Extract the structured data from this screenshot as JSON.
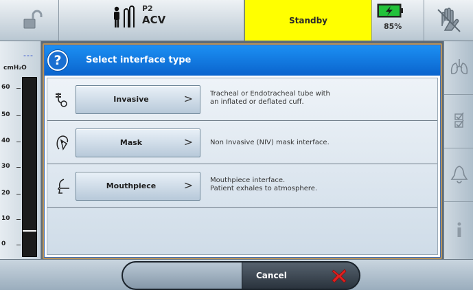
{
  "status_bar": {
    "mode_label": "P2",
    "mode_value": "ACV",
    "ventilation_state": "Standby",
    "battery_percent": "85%",
    "icons": [
      "unlock-icon",
      "patient-circuit-icon",
      "battery-charging-icon",
      "alarm-silence-hand-icon"
    ]
  },
  "pressure_gauge": {
    "current_value": "---",
    "unit": "cmH₂O",
    "ticks": [
      "60",
      "50",
      "40",
      "30",
      "20",
      "10",
      "0"
    ],
    "range": [
      0,
      60
    ]
  },
  "dialog": {
    "title": "Select interface type",
    "help_icon": "?",
    "options": [
      {
        "label": "Invasive",
        "icon": "tracheal-tube-icon",
        "description_lines": [
          "Tracheal or Endotracheal tube with",
          "an inflated or deflated cuff."
        ]
      },
      {
        "label": "Mask",
        "icon": "mask-face-icon",
        "description_lines": [
          "Non Invasive (NIV) mask interface."
        ]
      },
      {
        "label": "Mouthpiece",
        "icon": "mouthpiece-icon",
        "description_lines": [
          "Mouthpiece interface.",
          "Patient exhales to atmosphere."
        ]
      }
    ],
    "chevron": ">"
  },
  "sidebar": {
    "buttons": [
      "lungs-icon",
      "checklist-icon",
      "alarm-bell-icon",
      "info-icon"
    ]
  },
  "bottom_bar": {
    "cancel_label": "Cancel",
    "cancel_icon": "red-x-icon"
  },
  "colors": {
    "standby_bg": "#ffff00",
    "dialog_header": "#1c8ff3",
    "cancel_x": "#e02020",
    "battery_green": "#22c23a"
  }
}
